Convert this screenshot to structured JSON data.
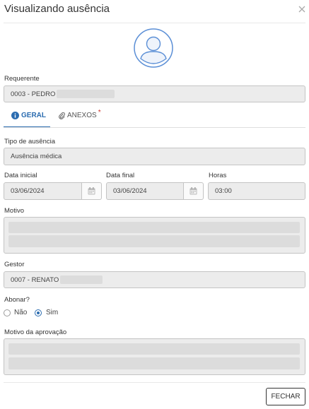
{
  "modal": {
    "title": "Visualizando ausência",
    "close_icon": "close-icon",
    "avatar_icon": "user-avatar-icon"
  },
  "requerente": {
    "label": "Requerente",
    "value": "0003 - PEDRO"
  },
  "tabs": [
    {
      "label": "GERAL",
      "icon": "info-icon",
      "active": true
    },
    {
      "label": "ANEXOS",
      "icon": "paperclip-icon",
      "required_mark": "*"
    }
  ],
  "tipo_ausencia": {
    "label": "Tipo de ausência",
    "value": "Ausência médica"
  },
  "data_inicial": {
    "label": "Data inicial",
    "value": "03/06/2024",
    "icon": "calendar-icon"
  },
  "data_final": {
    "label": "Data final",
    "value": "03/06/2024",
    "icon": "calendar-icon"
  },
  "horas": {
    "label": "Horas",
    "value": "03:00"
  },
  "motivo": {
    "label": "Motivo"
  },
  "gestor": {
    "label": "Gestor",
    "value": "0007 - RENATO"
  },
  "abonar": {
    "label": "Abonar?",
    "options": [
      {
        "label": "Não",
        "selected": false
      },
      {
        "label": "Sim",
        "selected": true
      }
    ]
  },
  "motivo_aprovacao": {
    "label": "Motivo da aprovação"
  },
  "footer": {
    "close_button": "FECHAR"
  },
  "colors": {
    "accent": "#2b6cb0",
    "field_bg": "#ececec",
    "required": "#d0342c"
  }
}
